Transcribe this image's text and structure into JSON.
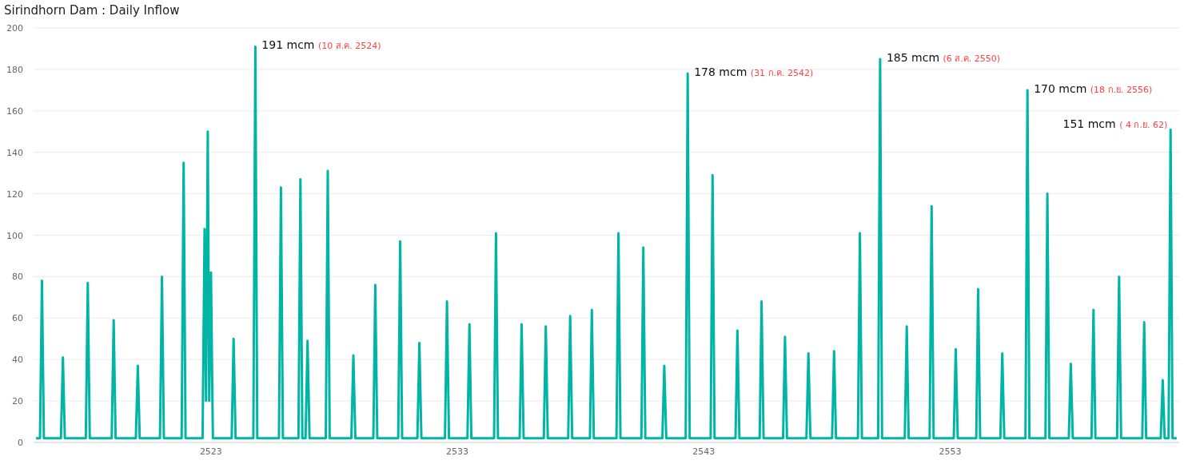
{
  "title": "Sirindhorn Dam : Daily Inflow",
  "chart_data": {
    "type": "line",
    "xlim": [
      2515.8,
      2562.3
    ],
    "ylim": [
      0,
      200
    ],
    "xticks": [
      2523,
      2533,
      2543,
      2553
    ],
    "yticks": [
      0,
      20,
      40,
      60,
      80,
      100,
      120,
      140,
      160,
      180,
      200
    ],
    "x": [
      2515.9,
      2516.06,
      2516.14,
      2516.22,
      2516.91,
      2516.99,
      2517.07,
      2517.92,
      2518.0,
      2518.08,
      2518.97,
      2519.05,
      2519.13,
      2519.95,
      2520.03,
      2520.11,
      2520.93,
      2521.01,
      2521.09,
      2521.81,
      2521.89,
      2521.97,
      2522.66,
      2522.74,
      2522.8,
      2522.87,
      2522.93,
      2523.0,
      2523.08,
      2523.84,
      2523.92,
      2524.0,
      2524.72,
      2524.8,
      2524.88,
      2525.76,
      2525.84,
      2525.92,
      2526.55,
      2526.63,
      2526.71,
      2526.84,
      2526.92,
      2527.0,
      2527.66,
      2527.74,
      2527.82,
      2528.7,
      2528.78,
      2528.86,
      2529.59,
      2529.67,
      2529.75,
      2530.6,
      2530.68,
      2530.76,
      2531.38,
      2531.46,
      2531.54,
      2532.5,
      2532.58,
      2532.66,
      2533.41,
      2533.49,
      2533.57,
      2534.49,
      2534.57,
      2534.65,
      2535.53,
      2535.61,
      2535.69,
      2536.51,
      2536.59,
      2536.67,
      2537.5,
      2537.58,
      2537.66,
      2538.38,
      2538.46,
      2538.54,
      2539.46,
      2539.54,
      2539.62,
      2540.47,
      2540.55,
      2540.63,
      2541.32,
      2541.4,
      2541.48,
      2542.27,
      2542.35,
      2542.43,
      2543.28,
      2543.36,
      2543.44,
      2544.29,
      2544.37,
      2544.45,
      2545.27,
      2545.35,
      2545.43,
      2546.22,
      2546.3,
      2546.38,
      2547.17,
      2547.25,
      2547.33,
      2548.21,
      2548.29,
      2548.37,
      2549.26,
      2549.34,
      2549.42,
      2550.08,
      2550.16,
      2550.24,
      2551.16,
      2551.24,
      2551.32,
      2552.17,
      2552.25,
      2552.33,
      2553.15,
      2553.23,
      2553.31,
      2554.06,
      2554.14,
      2554.22,
      2555.04,
      2555.12,
      2555.2,
      2556.06,
      2556.14,
      2556.22,
      2556.87,
      2556.95,
      2557.03,
      2557.82,
      2557.9,
      2557.98,
      2558.74,
      2558.82,
      2558.9,
      2559.78,
      2559.86,
      2559.94,
      2560.8,
      2560.88,
      2560.96,
      2561.55,
      2561.63,
      2561.71,
      2561.87,
      2561.95,
      2562.03,
      2562.2
    ],
    "grid": true,
    "series": [
      {
        "color": "#00b5a5",
        "values": [
          2,
          2,
          78,
          2,
          2,
          41,
          2,
          2,
          77,
          2,
          2,
          59,
          2,
          2,
          37,
          2,
          2,
          80,
          2,
          2,
          135,
          2,
          2,
          103,
          20,
          150,
          20,
          82,
          2,
          2,
          50,
          2,
          2,
          191,
          2,
          2,
          123,
          2,
          2,
          127,
          2,
          2,
          49,
          2,
          2,
          131,
          2,
          2,
          42,
          2,
          2,
          76,
          2,
          2,
          97,
          2,
          2,
          48,
          2,
          2,
          68,
          2,
          2,
          57,
          2,
          2,
          101,
          2,
          2,
          57,
          2,
          2,
          56,
          2,
          2,
          61,
          2,
          2,
          64,
          2,
          2,
          101,
          2,
          2,
          94,
          2,
          2,
          37,
          2,
          2,
          178,
          2,
          2,
          129,
          2,
          2,
          54,
          2,
          2,
          68,
          2,
          2,
          51,
          2,
          2,
          43,
          2,
          2,
          44,
          2,
          2,
          101,
          2,
          2,
          185,
          2,
          2,
          56,
          2,
          2,
          114,
          2,
          2,
          45,
          2,
          2,
          74,
          2,
          2,
          43,
          2,
          2,
          170,
          2,
          2,
          120,
          2,
          2,
          38,
          2,
          2,
          64,
          2,
          2,
          80,
          2,
          2,
          58,
          2,
          2,
          30,
          2,
          2,
          151,
          2,
          2
        ]
      }
    ],
    "annotations": [
      {
        "x": 2524.8,
        "y": 191,
        "text": "191 mcm (10 ส.ค. 2524)"
      },
      {
        "x": 2542.35,
        "y": 178,
        "text": "178 mcm (31 ก.ค. 2542)"
      },
      {
        "x": 2550.16,
        "y": 185,
        "text": "185 mcm (6 ส.ค. 2550)"
      },
      {
        "x": 2556.14,
        "y": 170,
        "text": "170 mcm (18 ก.ย. 2556)"
      },
      {
        "x": 2561.95,
        "y": 151,
        "text": "151 mcm ( 4 ก.ย. 62)"
      }
    ]
  }
}
